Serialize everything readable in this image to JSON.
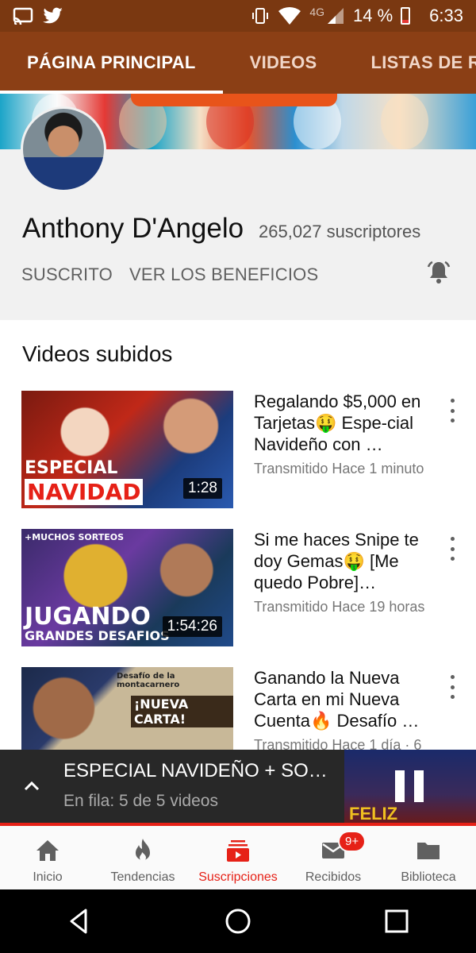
{
  "status_bar": {
    "network": "4G",
    "battery": "14 %",
    "time": "6:33",
    "icons": [
      "cast-icon",
      "twitter-icon",
      "vibrate-icon",
      "wifi-icon",
      "signal-icon",
      "battery-icon"
    ]
  },
  "tabs": [
    {
      "label": "PÁGINA PRINCIPAL",
      "active": true
    },
    {
      "label": "VIDEOS",
      "active": false
    },
    {
      "label": "LISTAS DE REPRODUCCIÓN",
      "active": false
    }
  ],
  "channel": {
    "name": "Anthony D'Angelo",
    "subscribers": "265,027 suscriptores",
    "subscribed_label": "SUSCRITO",
    "benefits_label": "VER LOS BENEFICIOS"
  },
  "section_title": "Videos subidos",
  "videos": [
    {
      "title": "Regalando $5,000 en Tarjetas🤑 Espe-cial Navideño con …",
      "meta": "Transmitido Hace 1 minuto",
      "duration": "1:28",
      "thumb_text_1": "ESPECIAL",
      "thumb_text_2": "NAVIDAD"
    },
    {
      "title": "Si me haces Snipe te doy Gemas🤑 [Me quedo Pobre]…",
      "meta": "Transmitido Hace 19 horas",
      "duration": "1:54:26",
      "thumb_text_1": "JUGANDO",
      "thumb_text_2": "GRANDES DESAFIOS",
      "thumb_text_top": "+MUCHOS SORTEOS"
    },
    {
      "title": "Ganando la Nueva Carta en mi Nueva Cuenta🔥 Desafío …",
      "meta": "Transmitido Hace 1 día · 6",
      "thumb_text_1": "¡NUEVA CARTA!",
      "thumb_text_top": "Desafío de la montacarnero"
    }
  ],
  "mini_player": {
    "title": "ESPECIAL NAVIDEÑO + SO…",
    "queue": "En fila: 5 de 5 videos",
    "thumb_text": "FELIZ NAVIDAD"
  },
  "bottom_nav": [
    {
      "label": "Inicio",
      "icon": "home-icon",
      "active": false
    },
    {
      "label": "Tendencias",
      "icon": "fire-icon",
      "active": false
    },
    {
      "label": "Suscripciones",
      "icon": "subscriptions-icon",
      "active": true
    },
    {
      "label": "Recibidos",
      "icon": "mail-icon",
      "active": false,
      "badge": "9+"
    },
    {
      "label": "Biblioteca",
      "icon": "folder-icon",
      "active": false
    }
  ],
  "colors": {
    "brand_brown": "#8b3f15",
    "status_brown": "#7a3811",
    "accent_red": "#e62117"
  }
}
